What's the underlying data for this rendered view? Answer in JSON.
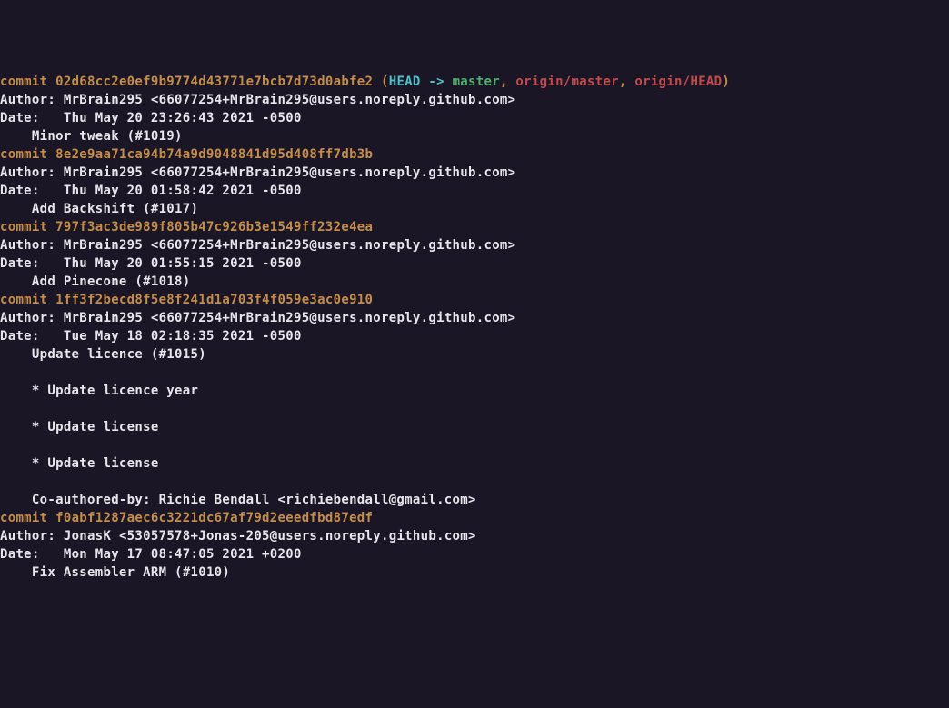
{
  "commits": [
    {
      "hash": "02d68cc2e0ef9b9774d43771e7bcb7d73d0abfe2",
      "refs": {
        "head_arrow": "HEAD -> ",
        "local_branch": "master",
        "remotes": [
          "origin/master",
          "origin/HEAD"
        ]
      },
      "author_label": "Author: ",
      "author": "MrBrain295 <66077254+MrBrain295@users.noreply.github.com>",
      "date_label": "Date:   ",
      "date": "Thu May 20 23:26:43 2021 -0500",
      "message_lines": [
        "    Minor tweak (#1019)"
      ]
    },
    {
      "hash": "8e2e9aa71ca94b74a9d9048841d95d408ff7db3b",
      "author_label": "Author: ",
      "author": "MrBrain295 <66077254+MrBrain295@users.noreply.github.com>",
      "date_label": "Date:   ",
      "date": "Thu May 20 01:58:42 2021 -0500",
      "message_lines": [
        "    Add Backshift (#1017)"
      ]
    },
    {
      "hash": "797f3ac3de989f805b47c926b3e1549ff232e4ea",
      "author_label": "Author: ",
      "author": "MrBrain295 <66077254+MrBrain295@users.noreply.github.com>",
      "date_label": "Date:   ",
      "date": "Thu May 20 01:55:15 2021 -0500",
      "message_lines": [
        "    Add Pinecone (#1018)"
      ]
    },
    {
      "hash": "1ff3f2becd8f5e8f241d1a703f4f059e3ac0e910",
      "author_label": "Author: ",
      "author": "MrBrain295 <66077254+MrBrain295@users.noreply.github.com>",
      "date_label": "Date:   ",
      "date": "Tue May 18 02:18:35 2021 -0500",
      "message_lines": [
        "    Update licence (#1015)",
        "",
        "    * Update licence year",
        "",
        "    * Update license",
        "",
        "    * Update license",
        "",
        "    Co-authored-by: Richie Bendall <richiebendall@gmail.com>"
      ]
    },
    {
      "hash": "f0abf1287aec6c3221dc67af79d2eeedfbd87edf",
      "author_label": "Author: ",
      "author": "JonasK <53057578+Jonas-205@users.noreply.github.com>",
      "date_label": "Date:   ",
      "date": "Mon May 17 08:47:05 2021 +0200",
      "message_lines": [
        "    Fix Assembler ARM (#1010)"
      ]
    }
  ],
  "commit_word": "commit "
}
